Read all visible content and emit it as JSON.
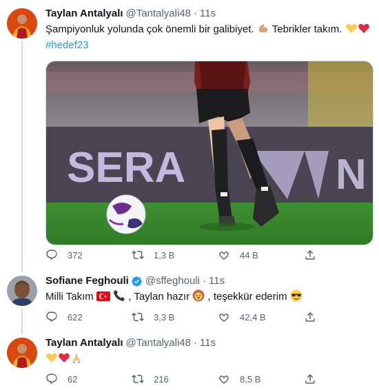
{
  "tweets": [
    {
      "author": "Taylan Antalyalı",
      "handle": "@Tantalyali48",
      "time": "11s",
      "text": "Şampiyonluk yolunda çok önemli bir galibiyet.",
      "text2": "Tebrikler takım.",
      "hashtag": "#hedef23",
      "replies": "372",
      "retweets": "1,3 B",
      "likes": "44 B"
    },
    {
      "author": "Sofiane Feghouli",
      "handle": "@sffeghouli",
      "time": "11s",
      "text_a": "Milli Takım",
      "text_b": ", Taylan hazır",
      "text_c": ", teşekkür ederim",
      "replies": "622",
      "retweets": "3,3 B",
      "likes": "42,4 B"
    },
    {
      "author": "Taylan Antalyalı",
      "handle": "@Tantalyali48",
      "time": "11s",
      "replies": "62",
      "retweets": "216",
      "likes": "8,5 B"
    }
  ],
  "media": {
    "board_text": "SERA"
  },
  "icons": [
    "reply-icon",
    "retweet-icon",
    "like-icon",
    "share-icon",
    "verified-icon"
  ],
  "colors": {
    "accent": "#1d9bf0",
    "secondary": "#536471",
    "thread_line": "#cfd9de"
  }
}
